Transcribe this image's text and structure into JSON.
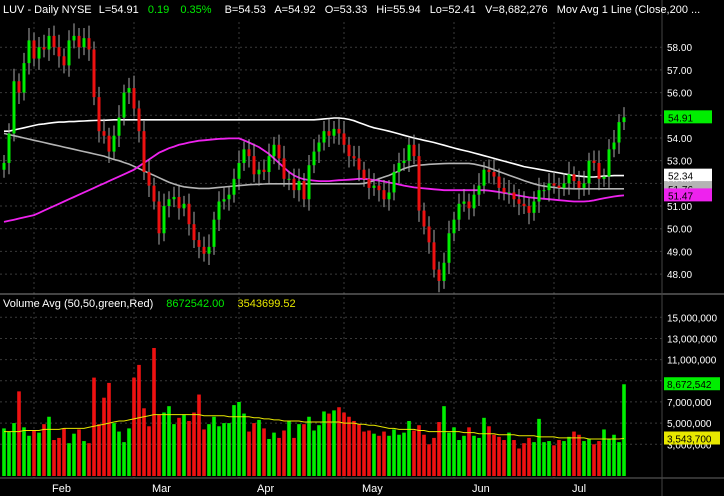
{
  "header": {
    "symbol": "LUV - Daily  NYSE",
    "last": "L=54.91",
    "change": "0.19",
    "change_pct": "0.35%",
    "bid": "B=54.53",
    "ask": "A=54.92",
    "open": "O=53.33",
    "high": "Hi=55.94",
    "low": "Lo=52.41",
    "volume": "V=8,682,276",
    "study": "Mov Avg 1 Line (Close,200 ..."
  },
  "volume_header": {
    "label": "Volume Avg (50,50,green,Red)",
    "value1": "8672542.00",
    "value2": "3543699.52"
  },
  "colors": {
    "up": "#00ee00",
    "down": "#ee1111",
    "ma_white": "#ffffff",
    "ma_gray": "#b4b4b4",
    "ma_magenta": "#ee22ee",
    "vol_avg": "#e8e800",
    "grid": "#3a3a3a",
    "text": "#ffffff"
  },
  "chart_data": {
    "type": "candlestick",
    "price_axis": {
      "ticks": [
        "58.00",
        "57.00",
        "56.00",
        "55.00",
        "54.00",
        "53.00",
        "52.00",
        "51.00",
        "50.00",
        "49.00",
        "48.00"
      ],
      "ylim": [
        47.3,
        59.2
      ]
    },
    "volume_axis": {
      "ticks": [
        "15,000,000",
        "13,000,000",
        "11,000,000",
        "9,000,000",
        "7,000,000",
        "5,000,000",
        "3,000,000"
      ],
      "ylim": [
        0,
        15500000
      ]
    },
    "months": [
      "Feb",
      "Mar",
      "Apr",
      "May",
      "Jun",
      "Jul"
    ],
    "month_index": [
      6,
      26,
      47,
      68,
      90,
      110
    ],
    "markers": [
      {
        "label": "54.91",
        "value": 54.91,
        "color": "#00ee00",
        "text": "#000"
      },
      {
        "label": "52.34",
        "value": 52.34,
        "color": "#ffffff",
        "text": "#000"
      },
      {
        "label": "51.76",
        "value": 51.76,
        "color": "#b4b4b4",
        "text": "#000"
      },
      {
        "label": "51.47",
        "value": 51.47,
        "color": "#ee22ee",
        "text": "#000"
      }
    ],
    "vol_markers": [
      {
        "label": "8,672,542",
        "value": 8672542,
        "color": "#00ee00",
        "text": "#000"
      },
      {
        "label": "3,543,700",
        "value": 3543700,
        "color": "#e8e800",
        "text": "#000"
      }
    ],
    "closes": [
      52.9,
      54.2,
      56.5,
      56.0,
      57.3,
      58.3,
      57.5,
      58.0,
      57.9,
      58.5,
      58.0,
      57.6,
      57.2,
      58.3,
      58.5,
      58.0,
      58.4,
      57.9,
      55.8,
      54.3,
      54.1,
      53.4,
      54.1,
      54.9,
      56.0,
      56.2,
      55.3,
      54.3,
      52.5,
      51.9,
      51.2,
      49.8,
      51.0,
      51.3,
      51.4,
      50.9,
      51.1,
      50.2,
      49.5,
      49.2,
      48.9,
      49.2,
      50.4,
      51.2,
      51.3,
      51.5,
      52.2,
      52.9,
      53.5,
      53.2,
      52.4,
      52.6,
      52.5,
      53.2,
      53.7,
      53.1,
      52.2,
      52.2,
      51.7,
      52.1,
      51.3,
      52.8,
      53.4,
      53.8,
      54.3,
      54.1,
      54.4,
      54.2,
      53.7,
      53.2,
      53.1,
      52.6,
      52.2,
      51.8,
      51.9,
      51.7,
      51.3,
      51.6,
      52.5,
      52.9,
      53.0,
      53.7,
      53.2,
      50.8,
      50.1,
      49.4,
      48.2,
      47.7,
      48.5,
      49.8,
      50.4,
      51.1,
      51.2,
      50.9,
      51.5,
      51.9,
      52.6,
      52.5,
      52.3,
      51.8,
      51.6,
      51.6,
      51.3,
      51.1,
      51.0,
      50.7,
      51.2,
      51.7,
      51.7,
      52.0,
      51.9,
      51.8,
      52.0,
      52.4,
      52.1,
      51.8,
      52.0,
      53.0,
      52.9,
      52.2,
      52.3,
      53.5,
      53.8,
      54.7,
      54.91
    ],
    "volumes": [
      4.5,
      4.2,
      5.0,
      8.0,
      4.6,
      3.8,
      4.3,
      4.1,
      4.9,
      5.6,
      3.4,
      3.6,
      4.5,
      3.1,
      4.0,
      4.4,
      3.3,
      3.1,
      9.3,
      4.9,
      7.4,
      8.8,
      5.0,
      4.2,
      3.2,
      4.5,
      9.3,
      10.5,
      6.4,
      4.7,
      12.1,
      5.8,
      6.0,
      6.6,
      4.9,
      5.5,
      5.8,
      5.2,
      6.0,
      7.7,
      4.4,
      4.9,
      5.6,
      4.7,
      5.0,
      5.0,
      6.7,
      7.0,
      5.9,
      4.2,
      5.0,
      5.3,
      4.5,
      3.5,
      4.1,
      3.6,
      4.3,
      5.2,
      3.6,
      4.9,
      4.9,
      5.6,
      4.3,
      4.8,
      6.1,
      5.9,
      6.2,
      6.5,
      6.0,
      5.6,
      5.2,
      4.9,
      4.2,
      4.3,
      4.0,
      3.8,
      4.2,
      3.8,
      4.4,
      3.9,
      4.1,
      5.2,
      4.3,
      4.8,
      3.9,
      3.0,
      3.6,
      5.1,
      6.6,
      4.1,
      4.6,
      3.4,
      3.8,
      4.6,
      3.8,
      3.6,
      5.5,
      4.7,
      3.9,
      3.7,
      3.4,
      4.1,
      3.4,
      2.6,
      3.1,
      3.6,
      3.2,
      5.4,
      3.2,
      3.3,
      2.9,
      3.4,
      3.3,
      3.7,
      4.2,
      3.9,
      3.3,
      3.5,
      3.0,
      3.3,
      4.4,
      3.5,
      3.9,
      3.2,
      8.67
    ],
    "ma200_white": [
      54.3,
      54.3,
      54.35,
      54.4,
      54.45,
      54.5,
      54.55,
      54.6,
      54.62,
      54.65,
      54.68,
      54.7,
      54.7,
      54.72,
      54.72,
      54.74,
      54.75,
      54.76,
      54.77,
      54.78,
      54.78,
      54.79,
      54.8,
      54.8,
      54.8,
      54.8,
      54.8,
      54.8,
      54.8,
      54.8,
      54.8,
      54.8,
      54.8,
      54.8,
      54.8,
      54.8,
      54.8,
      54.8,
      54.8,
      54.8,
      54.8,
      54.8,
      54.8,
      54.8,
      54.8,
      54.8,
      54.8,
      54.8,
      54.8,
      54.8,
      54.8,
      54.8,
      54.8,
      54.8,
      54.8,
      54.8,
      54.8,
      54.8,
      54.8,
      54.8,
      54.8,
      54.8,
      54.8,
      54.82,
      54.84,
      54.86,
      54.88,
      54.88,
      54.86,
      54.82,
      54.76,
      54.68,
      54.6,
      54.52,
      54.45,
      54.4,
      54.35,
      54.3,
      54.24,
      54.18,
      54.12,
      54.06,
      54.0,
      53.95,
      53.9,
      53.85,
      53.8,
      53.74,
      53.68,
      53.62,
      53.56,
      53.5,
      53.45,
      53.4,
      53.34,
      53.28,
      53.22,
      53.16,
      53.1,
      53.04,
      52.98,
      52.92,
      52.86,
      52.8,
      52.74,
      52.7,
      52.66,
      52.62,
      52.58,
      52.54,
      52.5,
      52.46,
      52.42,
      52.38,
      52.34,
      52.32,
      52.3,
      52.28,
      52.28,
      52.3,
      52.32,
      52.33,
      52.34,
      52.34,
      52.34
    ],
    "ma_gray": [
      54.2,
      54.15,
      54.1,
      54.05,
      54.0,
      53.95,
      53.9,
      53.85,
      53.8,
      53.75,
      53.7,
      53.65,
      53.6,
      53.55,
      53.5,
      53.45,
      53.4,
      53.35,
      53.3,
      53.25,
      53.2,
      53.12,
      53.05,
      53.0,
      52.92,
      52.85,
      52.75,
      52.65,
      52.55,
      52.45,
      52.35,
      52.25,
      52.15,
      52.05,
      51.97,
      51.9,
      51.85,
      51.82,
      51.8,
      51.78,
      51.78,
      51.78,
      51.8,
      51.82,
      51.84,
      51.86,
      51.88,
      51.9,
      51.92,
      51.94,
      51.95,
      51.96,
      51.97,
      51.98,
      51.98,
      51.98,
      51.98,
      51.98,
      51.98,
      51.98,
      51.98,
      51.98,
      51.98,
      51.98,
      51.98,
      51.98,
      51.98,
      51.98,
      51.98,
      51.98,
      51.98,
      51.98,
      52.0,
      52.05,
      52.12,
      52.2,
      52.28,
      52.35,
      52.45,
      52.55,
      52.65,
      52.72,
      52.78,
      52.8,
      52.82,
      52.84,
      52.85,
      52.86,
      52.87,
      52.88,
      52.88,
      52.88,
      52.88,
      52.88,
      52.85,
      52.8,
      52.75,
      52.68,
      52.6,
      52.52,
      52.44,
      52.36,
      52.28,
      52.2,
      52.12,
      52.05,
      51.98,
      51.92,
      51.88,
      51.85,
      51.82,
      51.8,
      51.78,
      51.77,
      51.76,
      51.76,
      51.76,
      51.76,
      51.76,
      51.76,
      51.76,
      51.76,
      51.76,
      51.76,
      51.76
    ],
    "ma_magenta": [
      50.3,
      50.35,
      50.4,
      50.45,
      50.5,
      50.55,
      50.6,
      50.7,
      50.8,
      50.9,
      51.0,
      51.1,
      51.2,
      51.3,
      51.4,
      51.5,
      51.6,
      51.7,
      51.8,
      51.9,
      52.0,
      52.1,
      52.2,
      52.3,
      52.4,
      52.5,
      52.6,
      52.75,
      52.9,
      53.05,
      53.2,
      53.35,
      53.45,
      53.55,
      53.62,
      53.7,
      53.75,
      53.8,
      53.84,
      53.88,
      53.9,
      53.92,
      53.94,
      53.96,
      53.97,
      53.98,
      53.98,
      53.98,
      53.9,
      53.8,
      53.7,
      53.6,
      53.45,
      53.3,
      53.1,
      52.9,
      52.7,
      52.5,
      52.35,
      52.25,
      52.18,
      52.15,
      52.12,
      52.1,
      52.1,
      52.1,
      52.12,
      52.14,
      52.15,
      52.16,
      52.18,
      52.2,
      52.2,
      52.18,
      52.15,
      52.12,
      52.08,
      52.04,
      52.0,
      51.95,
      51.9,
      51.86,
      51.82,
      51.8,
      51.78,
      51.76,
      51.74,
      51.72,
      51.7,
      51.7,
      51.7,
      51.7,
      51.7,
      51.7,
      51.7,
      51.7,
      51.7,
      51.68,
      51.65,
      51.62,
      51.58,
      51.54,
      51.5,
      51.46,
      51.42,
      51.38,
      51.36,
      51.34,
      51.32,
      51.3,
      51.28,
      51.26,
      51.24,
      51.22,
      51.2,
      51.2,
      51.2,
      51.22,
      51.25,
      51.3,
      51.34,
      51.38,
      51.42,
      51.45,
      51.47
    ],
    "vol_avg": [
      4.2,
      4.2,
      4.2,
      4.2,
      4.3,
      4.3,
      4.3,
      4.3,
      4.4,
      4.4,
      4.4,
      4.4,
      4.5,
      4.5,
      4.5,
      4.5,
      4.5,
      4.6,
      4.7,
      4.8,
      4.9,
      5.0,
      5.1,
      5.2,
      5.2,
      5.3,
      5.4,
      5.5,
      5.6,
      5.7,
      5.8,
      5.8,
      5.8,
      5.8,
      5.8,
      5.8,
      5.8,
      5.8,
      5.8,
      5.8,
      5.7,
      5.7,
      5.7,
      5.7,
      5.7,
      5.6,
      5.6,
      5.6,
      5.6,
      5.6,
      5.5,
      5.5,
      5.4,
      5.4,
      5.3,
      5.3,
      5.2,
      5.2,
      5.2,
      5.2,
      5.1,
      5.1,
      5.1,
      5.1,
      5.1,
      5.1,
      5.1,
      5.1,
      5.0,
      5.0,
      5.0,
      4.9,
      4.9,
      4.8,
      4.8,
      4.7,
      4.6,
      4.5,
      4.5,
      4.4,
      4.4,
      4.4,
      4.4,
      4.3,
      4.3,
      4.2,
      4.2,
      4.2,
      4.2,
      4.2,
      4.2,
      4.2,
      4.1,
      4.1,
      4.1,
      4.0,
      4.0,
      4.0,
      4.0,
      3.9,
      3.9,
      3.9,
      3.9,
      3.8,
      3.8,
      3.8,
      3.8,
      3.7,
      3.7,
      3.7,
      3.7,
      3.6,
      3.6,
      3.6,
      3.6,
      3.6,
      3.6,
      3.5,
      3.5,
      3.5,
      3.5,
      3.5,
      3.5,
      3.5,
      3.54
    ]
  }
}
